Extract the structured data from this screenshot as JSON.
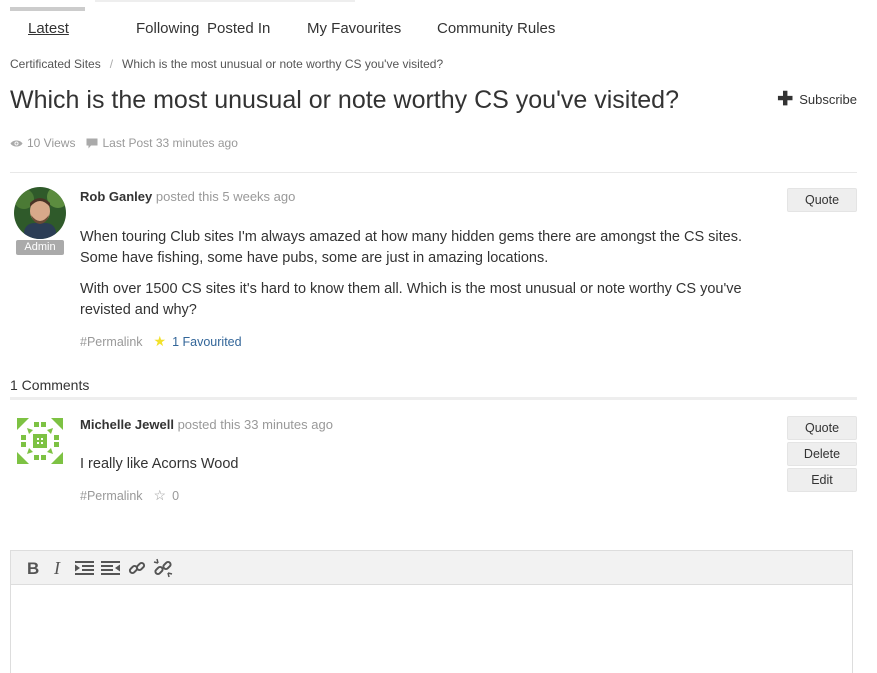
{
  "tabs": [
    {
      "label": "Latest",
      "active": true
    },
    {
      "label": "Following",
      "active": false
    },
    {
      "label": "Posted In",
      "active": false
    },
    {
      "label": "My Favourites",
      "active": false
    },
    {
      "label": "Community Rules",
      "active": false
    }
  ],
  "breadcrumb": {
    "parent": "Certificated Sites",
    "separator": "/",
    "current": "Which is the most unusual or note worthy CS you've visited?"
  },
  "topic": {
    "title": "Which is the most unusual or note worthy CS you've visited?",
    "subscribe_label": "Subscribe",
    "subscribe_icon": "plus-icon",
    "views": "10 Views",
    "last_post": "Last Post 33 minutes ago"
  },
  "post": {
    "author": "Rob Ganley",
    "posted": "posted this 5 weeks ago",
    "badge": "Admin",
    "paragraphs": [
      "When touring Club sites I'm always amazed at how many hidden gems there are amongst the CS sites. Some have fishing, some have pubs, some are just in amazing locations.",
      "With over 1500 CS sites it's hard to know them all. Which is the most unusual or note worthy CS you've revisted and why?"
    ],
    "permalink": "#Permalink",
    "favourited": "1 Favourited",
    "quote_label": "Quote",
    "star_color": "#f2e12b"
  },
  "comments": {
    "count_label": "1 Comments",
    "items": [
      {
        "author": "Michelle Jewell",
        "posted": "posted this 33 minutes ago",
        "body": "I really like Acorns Wood",
        "permalink": "#Permalink",
        "favourites": "0",
        "quote_label": "Quote",
        "delete_label": "Delete",
        "edit_label": "Edit",
        "avatar_color": "#7dc243"
      }
    ]
  },
  "editor": {
    "toolbar": [
      "bold-icon",
      "italic-icon",
      "indent-icon",
      "outdent-icon",
      "link-icon",
      "unlink-icon"
    ]
  }
}
